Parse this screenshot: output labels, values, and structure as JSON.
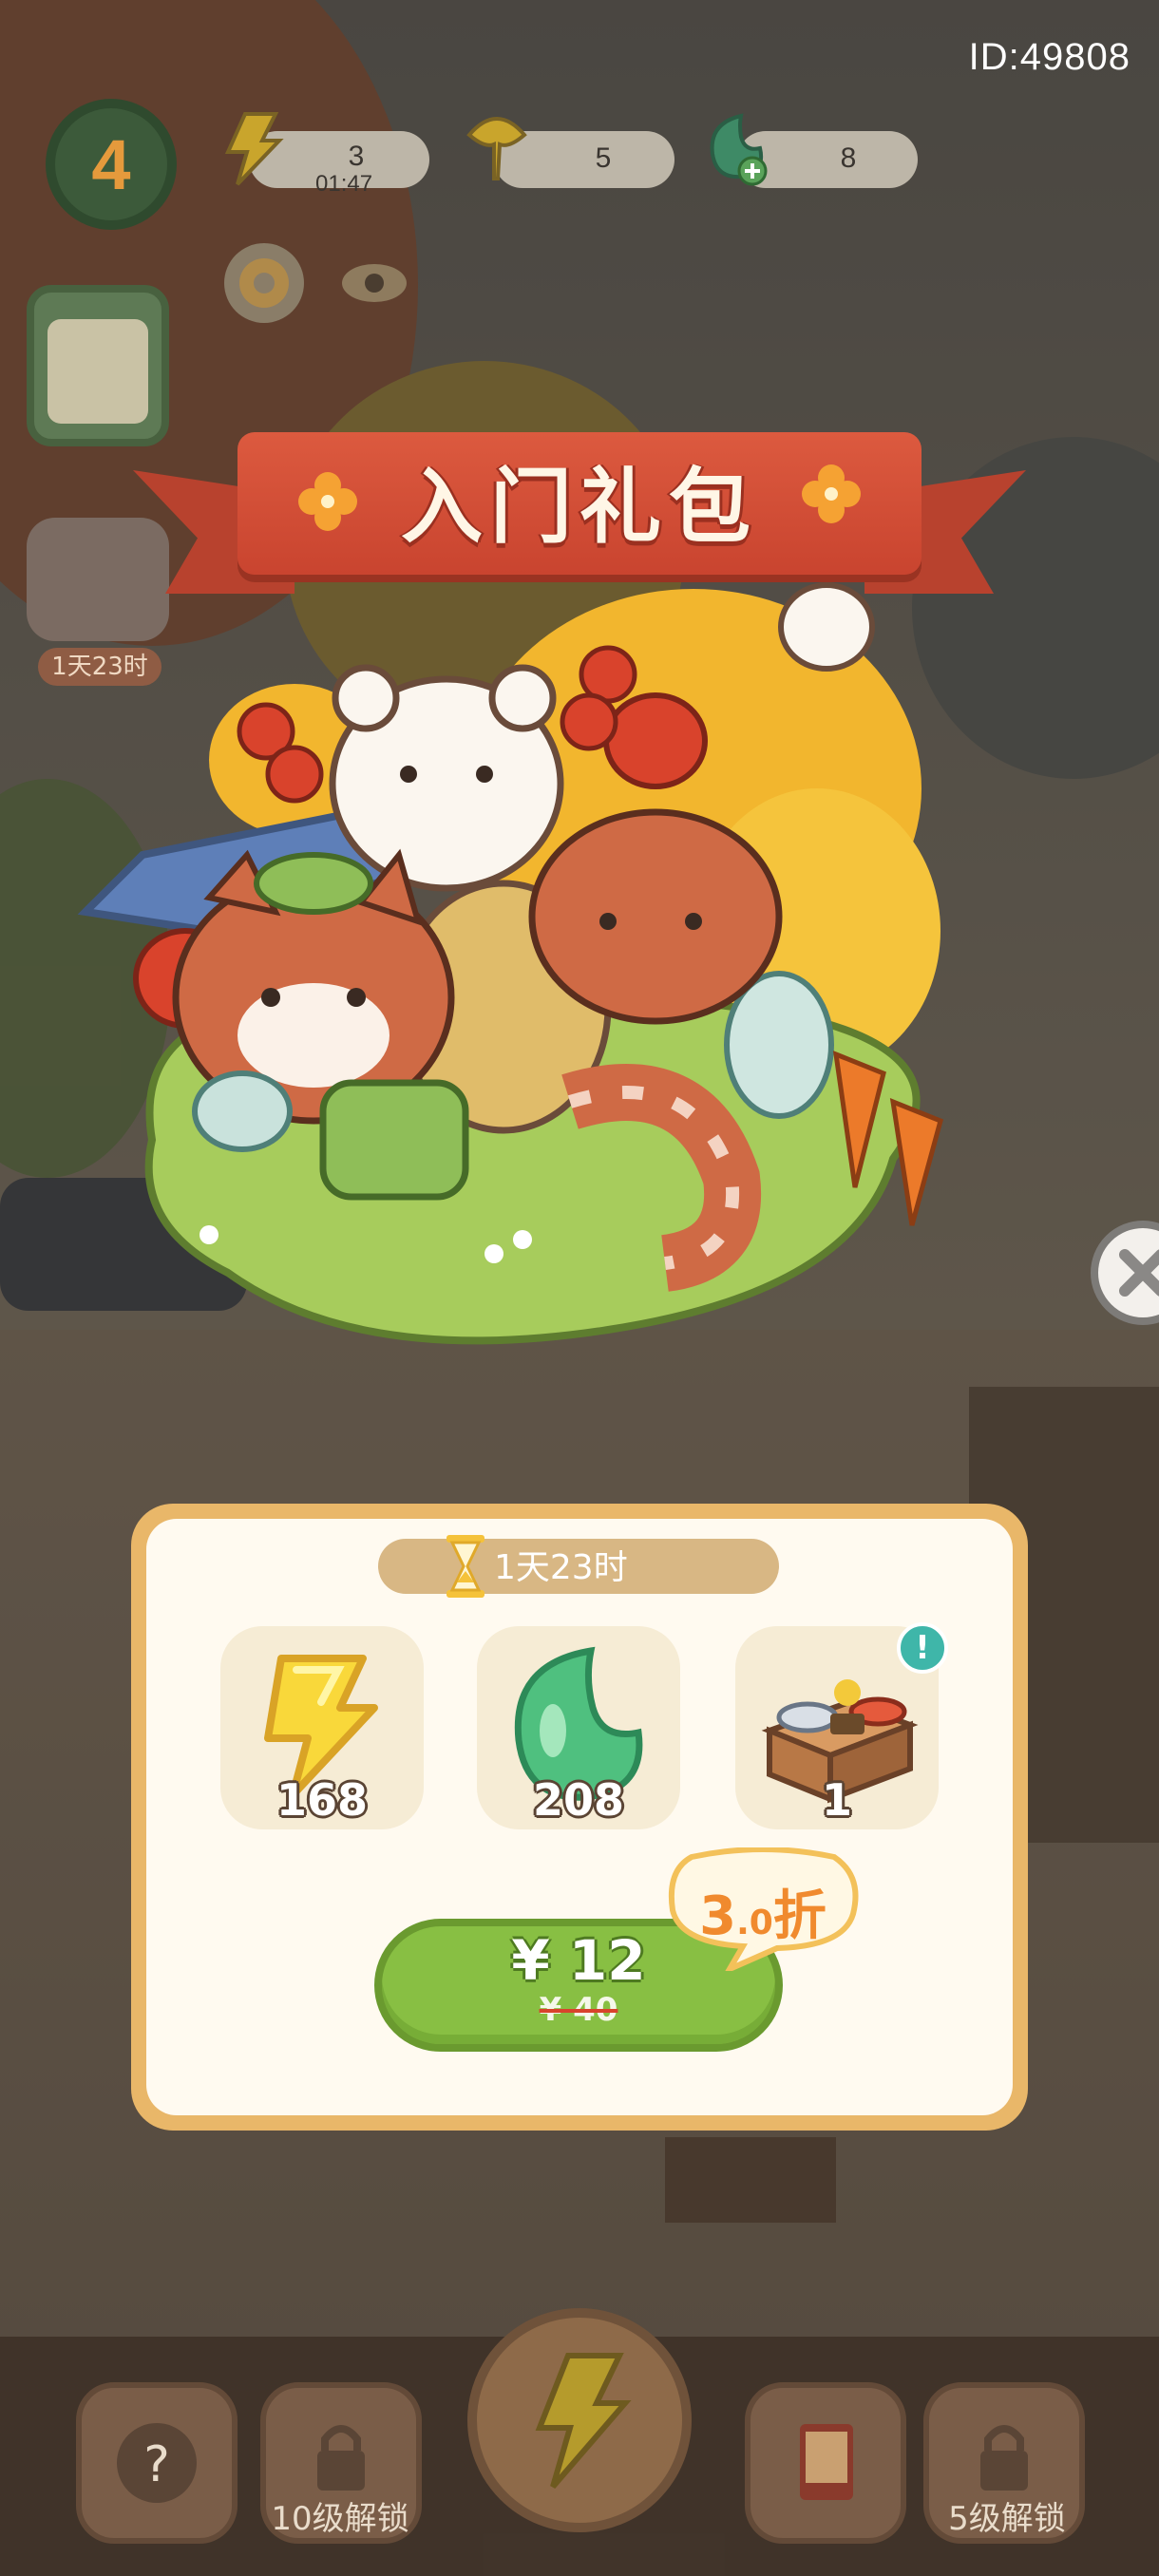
{
  "hud": {
    "player_id": "ID:49808",
    "level": "4",
    "energy": {
      "count": "3",
      "timer": "01:47",
      "icon": "lightning-icon"
    },
    "leaves": {
      "count": "5",
      "icon": "ginkgo-leaf-icon"
    },
    "gems": {
      "count": "8",
      "icon": "green-gem-plus-icon"
    },
    "settings_icon": "gear-icon",
    "view_icon": "eye-icon",
    "event_timer": "1天23时"
  },
  "banner": {
    "title": "入门礼包"
  },
  "package": {
    "timer": "1天23时",
    "items": [
      {
        "icon": "lightning-icon",
        "qty": "168"
      },
      {
        "icon": "green-gem-icon",
        "qty": "208"
      },
      {
        "icon": "food-crate-icon",
        "qty": "1"
      }
    ],
    "info_badge": "!",
    "price": "¥ 12",
    "original_price": "¥ 40",
    "discount_main": "3",
    "discount_decimal": ".0",
    "discount_unit": "折"
  },
  "bottom_bar": {
    "left_unlock": "10级解锁",
    "right_unlock": "5级解锁"
  },
  "colors": {
    "banner_red": "#c9442f",
    "panel_border": "#e9b769",
    "buy_green": "#88bf43",
    "discount_orange": "#f08a2e"
  }
}
